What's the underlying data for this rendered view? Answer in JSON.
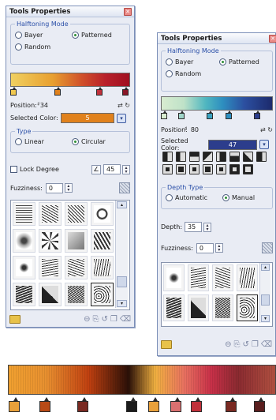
{
  "left_panel": {
    "title": "Tools Properties",
    "halftoning_legend": "Halftoning Mode",
    "bayer_label": "Bayer",
    "patterned_label": "Patterned",
    "random_label": "Random",
    "position_label": "Position:",
    "position_value": "34",
    "selected_color_label": "Selected Color:",
    "selected_color_value": "5",
    "type_legend": "Type",
    "linear_label": "Linear",
    "circular_label": "Circular",
    "lock_degree_label": "Lock Degree",
    "degree_value": "45",
    "fuzziness_label": "Fuzziness:",
    "fuzziness_value": "0"
  },
  "right_panel": {
    "title": "Tools Properties",
    "halftoning_legend": "Halftoning Mode",
    "bayer_label": "Bayer",
    "patterned_label": "Patterned",
    "random_label": "Random",
    "position_label": "Position:",
    "position_value": "80",
    "selected_color_label": "Selected Color:",
    "selected_color_value": "47",
    "depth_type_legend": "Depth Type",
    "automatic_label": "Automatic",
    "manual_label": "Manual",
    "depth_label": "Depth:",
    "depth_value": "35",
    "fuzziness_label": "Fuzziness:",
    "fuzziness_value": "0"
  },
  "colors": {
    "left_selected": "#e0811c",
    "right_selected": "#2c3d8c",
    "accent_group": "#2a4fa8"
  },
  "bottom_stops": [
    "#e8a03a",
    "#b84a16",
    "#7a2a22",
    "#1b1b1b",
    "#e8a03a",
    "#d97070",
    "#c0303a",
    "#7a2a22",
    "#5a1e1e"
  ]
}
